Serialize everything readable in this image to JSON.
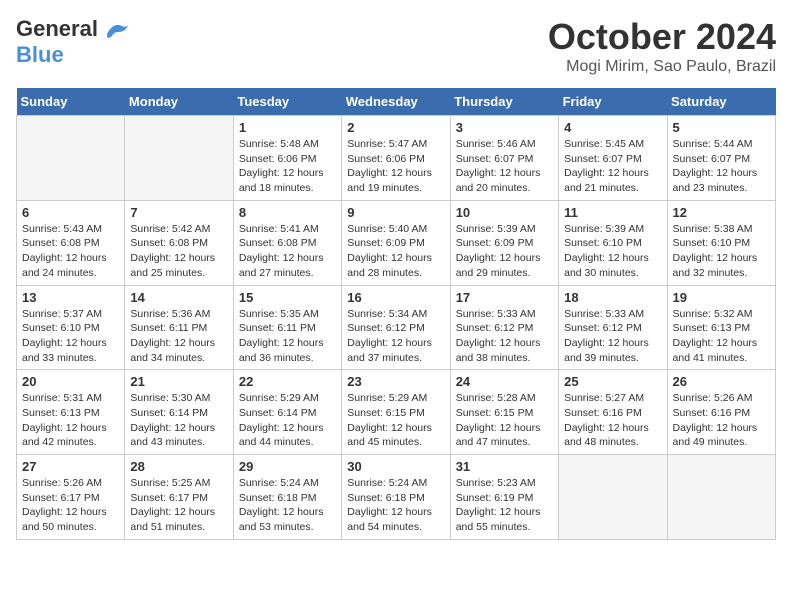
{
  "header": {
    "logo_line1": "General",
    "logo_line2": "Blue",
    "month": "October 2024",
    "location": "Mogi Mirim, Sao Paulo, Brazil"
  },
  "days_of_week": [
    "Sunday",
    "Monday",
    "Tuesday",
    "Wednesday",
    "Thursday",
    "Friday",
    "Saturday"
  ],
  "weeks": [
    [
      {
        "num": "",
        "empty": true
      },
      {
        "num": "",
        "empty": true
      },
      {
        "num": "1",
        "sunrise": "5:48 AM",
        "sunset": "6:06 PM",
        "daylight": "12 hours and 18 minutes."
      },
      {
        "num": "2",
        "sunrise": "5:47 AM",
        "sunset": "6:06 PM",
        "daylight": "12 hours and 19 minutes."
      },
      {
        "num": "3",
        "sunrise": "5:46 AM",
        "sunset": "6:07 PM",
        "daylight": "12 hours and 20 minutes."
      },
      {
        "num": "4",
        "sunrise": "5:45 AM",
        "sunset": "6:07 PM",
        "daylight": "12 hours and 21 minutes."
      },
      {
        "num": "5",
        "sunrise": "5:44 AM",
        "sunset": "6:07 PM",
        "daylight": "12 hours and 23 minutes."
      }
    ],
    [
      {
        "num": "6",
        "sunrise": "5:43 AM",
        "sunset": "6:08 PM",
        "daylight": "12 hours and 24 minutes."
      },
      {
        "num": "7",
        "sunrise": "5:42 AM",
        "sunset": "6:08 PM",
        "daylight": "12 hours and 25 minutes."
      },
      {
        "num": "8",
        "sunrise": "5:41 AM",
        "sunset": "6:08 PM",
        "daylight": "12 hours and 27 minutes."
      },
      {
        "num": "9",
        "sunrise": "5:40 AM",
        "sunset": "6:09 PM",
        "daylight": "12 hours and 28 minutes."
      },
      {
        "num": "10",
        "sunrise": "5:39 AM",
        "sunset": "6:09 PM",
        "daylight": "12 hours and 29 minutes."
      },
      {
        "num": "11",
        "sunrise": "5:39 AM",
        "sunset": "6:10 PM",
        "daylight": "12 hours and 30 minutes."
      },
      {
        "num": "12",
        "sunrise": "5:38 AM",
        "sunset": "6:10 PM",
        "daylight": "12 hours and 32 minutes."
      }
    ],
    [
      {
        "num": "13",
        "sunrise": "5:37 AM",
        "sunset": "6:10 PM",
        "daylight": "12 hours and 33 minutes."
      },
      {
        "num": "14",
        "sunrise": "5:36 AM",
        "sunset": "6:11 PM",
        "daylight": "12 hours and 34 minutes."
      },
      {
        "num": "15",
        "sunrise": "5:35 AM",
        "sunset": "6:11 PM",
        "daylight": "12 hours and 36 minutes."
      },
      {
        "num": "16",
        "sunrise": "5:34 AM",
        "sunset": "6:12 PM",
        "daylight": "12 hours and 37 minutes."
      },
      {
        "num": "17",
        "sunrise": "5:33 AM",
        "sunset": "6:12 PM",
        "daylight": "12 hours and 38 minutes."
      },
      {
        "num": "18",
        "sunrise": "5:33 AM",
        "sunset": "6:12 PM",
        "daylight": "12 hours and 39 minutes."
      },
      {
        "num": "19",
        "sunrise": "5:32 AM",
        "sunset": "6:13 PM",
        "daylight": "12 hours and 41 minutes."
      }
    ],
    [
      {
        "num": "20",
        "sunrise": "5:31 AM",
        "sunset": "6:13 PM",
        "daylight": "12 hours and 42 minutes."
      },
      {
        "num": "21",
        "sunrise": "5:30 AM",
        "sunset": "6:14 PM",
        "daylight": "12 hours and 43 minutes."
      },
      {
        "num": "22",
        "sunrise": "5:29 AM",
        "sunset": "6:14 PM",
        "daylight": "12 hours and 44 minutes."
      },
      {
        "num": "23",
        "sunrise": "5:29 AM",
        "sunset": "6:15 PM",
        "daylight": "12 hours and 45 minutes."
      },
      {
        "num": "24",
        "sunrise": "5:28 AM",
        "sunset": "6:15 PM",
        "daylight": "12 hours and 47 minutes."
      },
      {
        "num": "25",
        "sunrise": "5:27 AM",
        "sunset": "6:16 PM",
        "daylight": "12 hours and 48 minutes."
      },
      {
        "num": "26",
        "sunrise": "5:26 AM",
        "sunset": "6:16 PM",
        "daylight": "12 hours and 49 minutes."
      }
    ],
    [
      {
        "num": "27",
        "sunrise": "5:26 AM",
        "sunset": "6:17 PM",
        "daylight": "12 hours and 50 minutes."
      },
      {
        "num": "28",
        "sunrise": "5:25 AM",
        "sunset": "6:17 PM",
        "daylight": "12 hours and 51 minutes."
      },
      {
        "num": "29",
        "sunrise": "5:24 AM",
        "sunset": "6:18 PM",
        "daylight": "12 hours and 53 minutes."
      },
      {
        "num": "30",
        "sunrise": "5:24 AM",
        "sunset": "6:18 PM",
        "daylight": "12 hours and 54 minutes."
      },
      {
        "num": "31",
        "sunrise": "5:23 AM",
        "sunset": "6:19 PM",
        "daylight": "12 hours and 55 minutes."
      },
      {
        "num": "",
        "empty": true
      },
      {
        "num": "",
        "empty": true
      }
    ]
  ],
  "labels": {
    "sunrise_prefix": "Sunrise: ",
    "sunset_prefix": "Sunset: ",
    "daylight_prefix": "Daylight: "
  }
}
